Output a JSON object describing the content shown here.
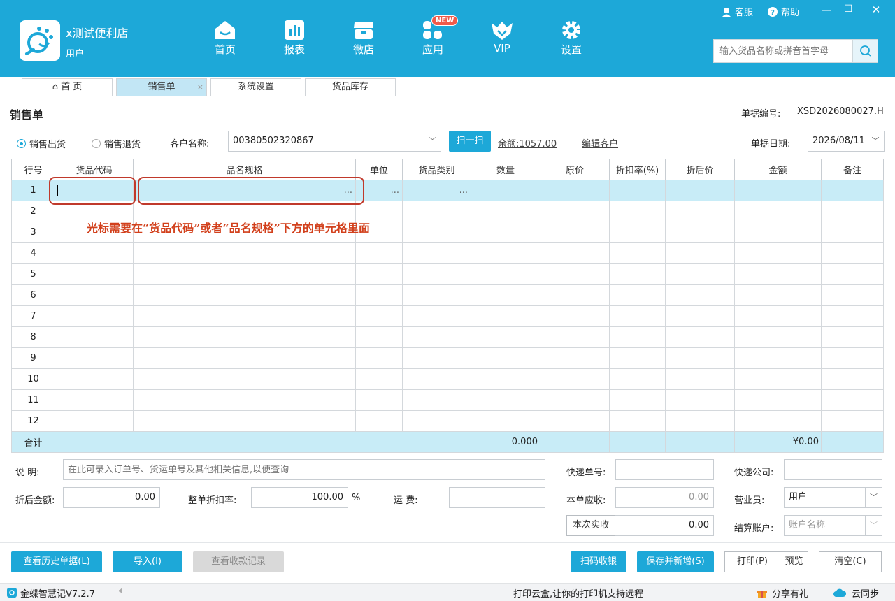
{
  "app": {
    "store_name": "x测试便利店",
    "user": "用户"
  },
  "nav": [
    {
      "label": "首页",
      "icon": "home-icon"
    },
    {
      "label": "报表",
      "icon": "report-icon"
    },
    {
      "label": "微店",
      "icon": "shop-icon"
    },
    {
      "label": "应用",
      "icon": "apps-icon",
      "badge": "NEW"
    },
    {
      "label": "VIP",
      "icon": "vip-icon"
    },
    {
      "label": "设置",
      "icon": "gear-icon"
    }
  ],
  "top_right": {
    "service": "客服",
    "help": "帮助"
  },
  "search": {
    "placeholder": "输入货品名称或拼音首字母"
  },
  "tabs": [
    {
      "label": "首 页"
    },
    {
      "label": "销售单",
      "close": "×"
    },
    {
      "label": "系统设置"
    },
    {
      "label": "货品库存"
    }
  ],
  "form": {
    "title": "销售单",
    "bill_no_label": "单据编号:",
    "bill_no": "XSD2026080027.H",
    "radio_sale": "销售出货",
    "radio_return": "销售退货",
    "customer_label": "客户名称:",
    "customer_value": "00380502320867",
    "scan_btn": "扫一扫",
    "balance": "余额:1057.00",
    "edit_customer": "编辑客户",
    "date_label": "单据日期:",
    "date_value": "2026/08/11"
  },
  "table": {
    "headers": [
      "行号",
      "货品代码",
      "品名规格",
      "单位",
      "货品类别",
      "数量",
      "原价",
      "折扣率(%)",
      "折后价",
      "金额",
      "备注"
    ],
    "rows": [
      "1",
      "2",
      "3",
      "4",
      "5",
      "6",
      "7",
      "8",
      "9",
      "10",
      "11",
      "12"
    ],
    "dots": "...",
    "total_label": "合计",
    "total_qty": "0.000",
    "total_amount": "¥0.00"
  },
  "annotation": "光标需要在“货品代码”或者“品名规格”下方的单元格里面",
  "footer_form": {
    "note_label": "说 明:",
    "note_placeholder": "在此可录入订单号、货运单号及其他相关信息,以便查询",
    "express_no_label": "快递单号:",
    "express_co_label": "快递公司:",
    "discount_amount_label": "折后金额:",
    "discount_amount": "0.00",
    "whole_discount_label": "整单折扣率:",
    "whole_discount": "100.00",
    "percent": "%",
    "freight_label": "运 费:",
    "receivable_label": "本单应收:",
    "receivable": "0.00",
    "salesman_label": "营业员:",
    "salesman": "用户",
    "actual_btn": "本次实收",
    "actual": "0.00",
    "account_label": "结算账户:",
    "account_placeholder": "账户名称"
  },
  "buttons": {
    "history": "查看历史单据(L)",
    "import": "导入(I)",
    "receipts": "查看收款记录",
    "scan_pay": "扫码收银",
    "save_new": "保存并新增(S)",
    "print": "打印(P)",
    "preview": "预览",
    "clear": "清空(C)"
  },
  "status": {
    "version": "金蝶智慧记V7.2.7",
    "notice": "打印云盒,让你的打印机支持远程",
    "share": "分享有礼",
    "sync": "云同步"
  },
  "colors": {
    "primary": "#1da8d8",
    "selected_row": "#c8ecf7",
    "annotation": "#d2401c"
  }
}
